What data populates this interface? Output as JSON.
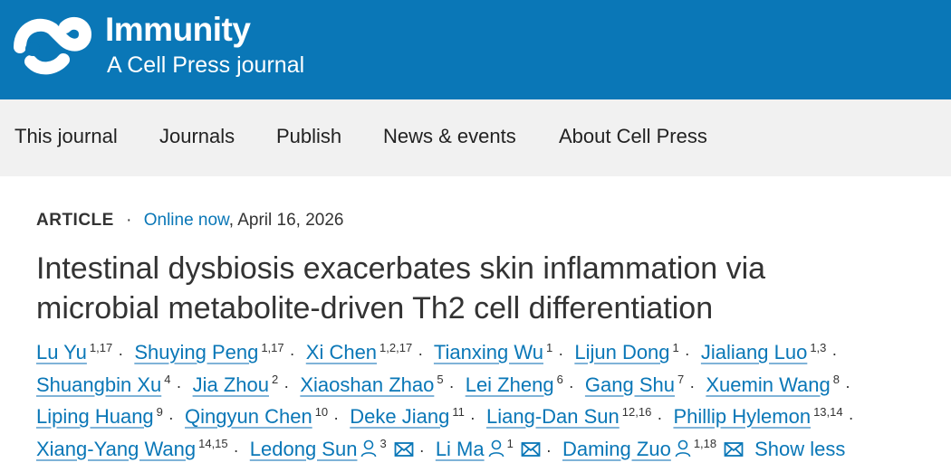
{
  "brand": {
    "title": "Immunity",
    "subtitle": "A Cell Press journal"
  },
  "colors": {
    "brand": "#0a77b7",
    "nav_bg": "#f1f1f1",
    "link": "#0a77b7"
  },
  "nav": [
    {
      "label": "This journal"
    },
    {
      "label": "Journals"
    },
    {
      "label": "Publish"
    },
    {
      "label": "News & events"
    },
    {
      "label": "About Cell Press"
    }
  ],
  "article": {
    "type": "ARTICLE",
    "status": "Online now",
    "date": ", April 16, 2026",
    "title_line1": "Intestinal dysbiosis exacerbates skin inflammation via",
    "title_line2": "microbial metabolite-driven Th2 cell differentiation",
    "show_less": "Show less"
  },
  "authors": [
    {
      "name": "Lu Yu",
      "aff": "1,17"
    },
    {
      "name": "Shuying Peng",
      "aff": "1,17"
    },
    {
      "name": "Xi Chen",
      "aff": "1,2,17"
    },
    {
      "name": "Tianxing Wu",
      "aff": "1"
    },
    {
      "name": "Lijun Dong",
      "aff": "1"
    },
    {
      "name": "Jialiang Luo",
      "aff": "1,3"
    },
    {
      "name": "Shuangbin Xu",
      "aff": "4"
    },
    {
      "name": "Jia Zhou",
      "aff": "2"
    },
    {
      "name": "Xiaoshan Zhao",
      "aff": "5"
    },
    {
      "name": "Lei Zheng",
      "aff": "6"
    },
    {
      "name": "Gang Shu",
      "aff": "7"
    },
    {
      "name": "Xuemin Wang",
      "aff": "8"
    },
    {
      "name": "Liping Huang",
      "aff": "9"
    },
    {
      "name": "Qingyun Chen",
      "aff": "10"
    },
    {
      "name": "Deke Jiang",
      "aff": "11"
    },
    {
      "name": "Liang-Dan Sun",
      "aff": "12,16"
    },
    {
      "name": "Phillip Hylemon",
      "aff": "13,14"
    },
    {
      "name": "Xiang-Yang Wang",
      "aff": "14,15"
    },
    {
      "name": "Ledong Sun",
      "aff": "3",
      "icons": [
        "person-icon",
        "email-icon"
      ]
    },
    {
      "name": "Li Ma",
      "aff": "1",
      "icons": [
        "person-icon",
        "email-icon"
      ]
    },
    {
      "name": "Daming Zuo",
      "aff": "1,18",
      "icons": [
        "person-icon",
        "email-icon"
      ]
    }
  ]
}
